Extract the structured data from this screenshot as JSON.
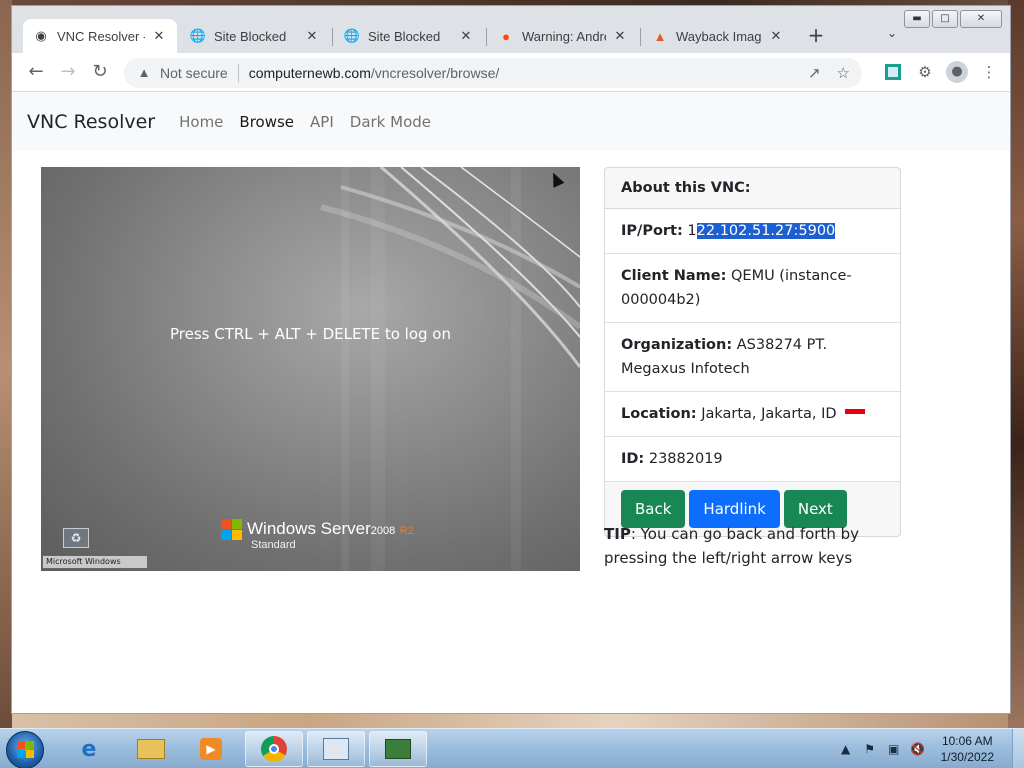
{
  "tabs": [
    {
      "title": "VNC Resolver - Browse",
      "icon": "vnc-resolver-favicon",
      "active": true
    },
    {
      "title": "Site Blocked",
      "icon": "globe-icon",
      "active": false
    },
    {
      "title": "Site Blocked",
      "icon": "globe-icon",
      "active": false
    },
    {
      "title": "Warning: Andrej",
      "icon": "reddit-icon",
      "active": false
    },
    {
      "title": "Wayback Images",
      "icon": "wayback-icon",
      "active": false
    }
  ],
  "toolbar": {
    "security_text": "Not secure",
    "url_host": "computernewb.com",
    "url_path": "/vncresolver/browse/"
  },
  "navbar": {
    "brand": "VNC Resolver",
    "links": [
      "Home",
      "Browse",
      "API",
      "Dark Mode"
    ]
  },
  "screenshot": {
    "logon_text": "Press CTRL + ALT + DELETE to log on",
    "taskbar_text": "Microsoft Windows",
    "product_name": "Windows Server",
    "product_version": "2008",
    "product_release": "R2",
    "product_edition": "Standard"
  },
  "card": {
    "header": "About this VNC:",
    "ip_label": "IP/Port:",
    "ip_prefix": "1",
    "ip_selected": "22.102.51.27:5900",
    "client_label": "Client Name:",
    "client_value": "QEMU (instance-000004b2)",
    "org_label": "Organization:",
    "org_value": "AS38274 PT. Megaxus Infotech",
    "location_label": "Location:",
    "location_value": "Jakarta, Jakarta, ID",
    "id_label": "ID:",
    "id_value": "23882019",
    "buttons": {
      "back": "Back",
      "hardlink": "Hardlink",
      "next": "Next"
    }
  },
  "tip": {
    "label": "TIP",
    "text": ": You can go back and forth by pressing the left/right arrow keys"
  },
  "taskbar": {
    "time": "10:06 AM",
    "date": "1/30/2022"
  },
  "colors": {
    "success": "#198754",
    "primary": "#0d6efd",
    "selection": "#1e5fcf"
  }
}
